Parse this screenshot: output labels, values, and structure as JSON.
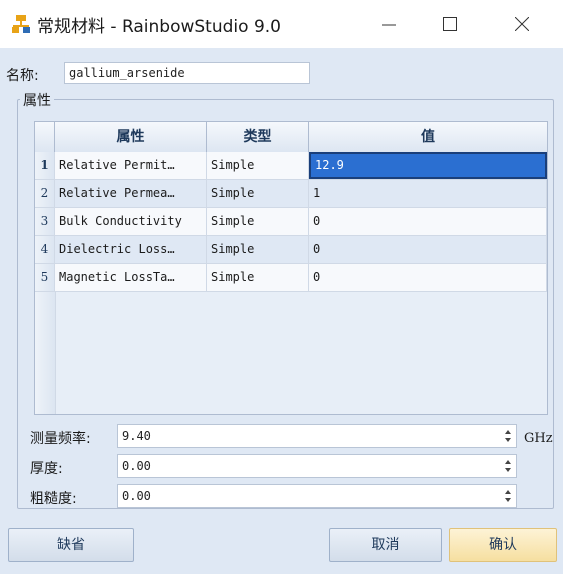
{
  "window": {
    "title": "常规材料 - RainbowStudio 9.0",
    "controls": [
      "minimize-icon",
      "maximize-icon",
      "close-icon"
    ]
  },
  "name": {
    "label": "名称:",
    "value": "gallium_arsenide"
  },
  "group": {
    "title": "属性"
  },
  "grid": {
    "columns": [
      "属性",
      "类型",
      "值"
    ],
    "rows": [
      {
        "num": "1",
        "property": "Relative Permit…",
        "type": "Simple",
        "value": "12.9"
      },
      {
        "num": "2",
        "property": "Relative Permea…",
        "type": "Simple",
        "value": "1"
      },
      {
        "num": "3",
        "property": "Bulk Conductivity",
        "type": "Simple",
        "value": "0"
      },
      {
        "num": "4",
        "property": "Dielectric Loss…",
        "type": "Simple",
        "value": "0"
      },
      {
        "num": "5",
        "property": "Magnetic LossTa…",
        "type": "Simple",
        "value": "0"
      }
    ],
    "selected_row": 1
  },
  "fields": {
    "frequency": {
      "label": "测量频率:",
      "value": "9.40",
      "unit": "GHz"
    },
    "thickness": {
      "label": "厚度:",
      "value": "0.00"
    },
    "roughness": {
      "label": "粗糙度:",
      "value": "0.00"
    }
  },
  "buttons": {
    "default": "缺省",
    "cancel": "取消",
    "ok": "确认"
  },
  "colors": {
    "accent": "#2b6fd1",
    "window_bg": "#dfe8f4",
    "ok_button": "#f6dfa0"
  }
}
